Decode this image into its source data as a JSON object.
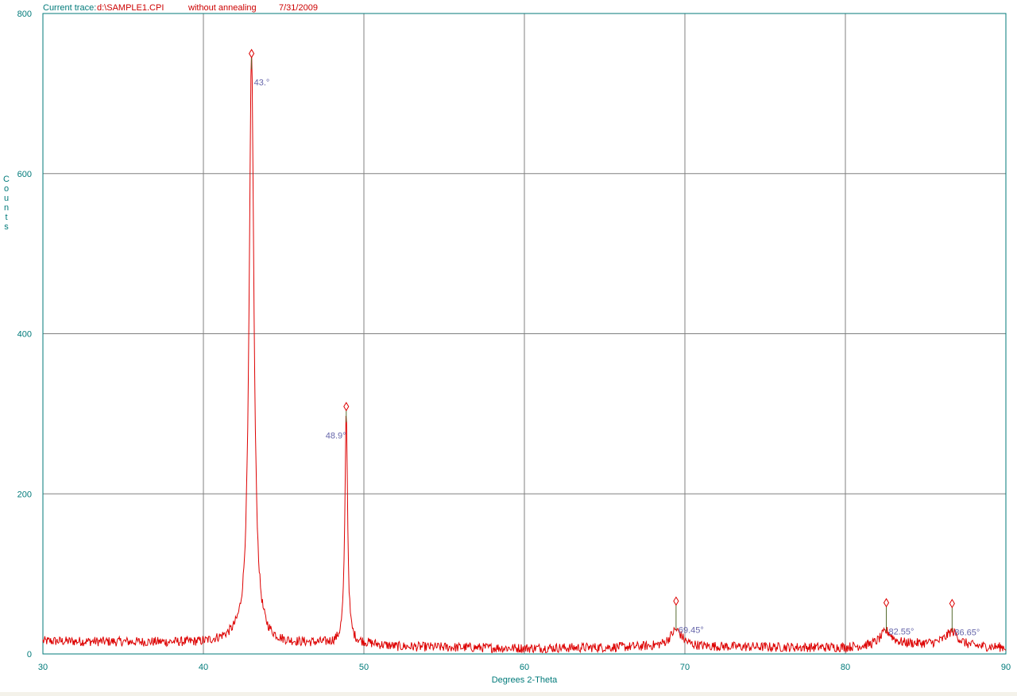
{
  "header": {
    "label": "Current trace:",
    "file": "d:\\SAMPLE1.CPI",
    "description": "without annealing",
    "date": "7/31/2009"
  },
  "colors": {
    "axis": "#007a7a",
    "grid": "#808080",
    "trace": "#dd0000",
    "peak_label": "#6666aa",
    "peak_marker": "#556b2f"
  },
  "chart_data": {
    "type": "line",
    "title": "",
    "xlabel": "Degrees 2-Theta",
    "ylabel": "Counts",
    "xlim": [
      30,
      90
    ],
    "ylim": [
      0,
      800
    ],
    "x_ticks": [
      30,
      40,
      50,
      60,
      70,
      80,
      90
    ],
    "y_ticks": [
      0,
      200,
      400,
      600,
      800
    ],
    "grid": true,
    "baseline": [
      [
        30,
        16
      ],
      [
        40,
        14
      ],
      [
        42,
        18
      ],
      [
        45,
        13
      ],
      [
        47,
        13
      ],
      [
        50,
        13
      ],
      [
        52,
        9
      ],
      [
        60,
        7
      ],
      [
        65,
        8
      ],
      [
        68,
        9
      ],
      [
        72,
        9
      ],
      [
        78,
        8
      ],
      [
        80,
        8
      ],
      [
        84,
        12
      ],
      [
        86,
        12
      ],
      [
        88,
        9
      ],
      [
        90,
        8
      ]
    ],
    "peaks": [
      {
        "label": "43.°",
        "x": 43.0,
        "y": 750,
        "marker": 750
      },
      {
        "label": "48.9°",
        "x": 48.9,
        "y": 305,
        "marker": 309
      },
      {
        "label": "69.45°",
        "x": 69.45,
        "y": 30,
        "marker": 66
      },
      {
        "label": "82.55°",
        "x": 82.55,
        "y": 28,
        "marker": 64
      },
      {
        "label": "86.65°",
        "x": 86.65,
        "y": 28,
        "marker": 63
      }
    ]
  }
}
